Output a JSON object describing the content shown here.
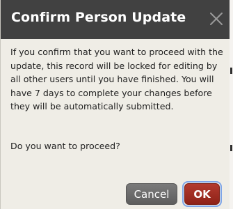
{
  "dialog": {
    "title": "Confirm Person Update",
    "close_icon": "close-x-icon",
    "message": "If you confirm that you want to proceed with the update, this record will be locked for editing by all other users until you have finished. You will have 7 days to complete your changes before they will be automatically submitted.",
    "question": "Do you want to proceed?",
    "buttons": {
      "cancel_label": "Cancel",
      "ok_label": "OK"
    }
  },
  "colors": {
    "titlebar": "#414141",
    "body": "#efede6",
    "cancel_button": "#6b6b6b",
    "ok_button": "#a0291e",
    "focus_ring": "#7fa6e8"
  }
}
